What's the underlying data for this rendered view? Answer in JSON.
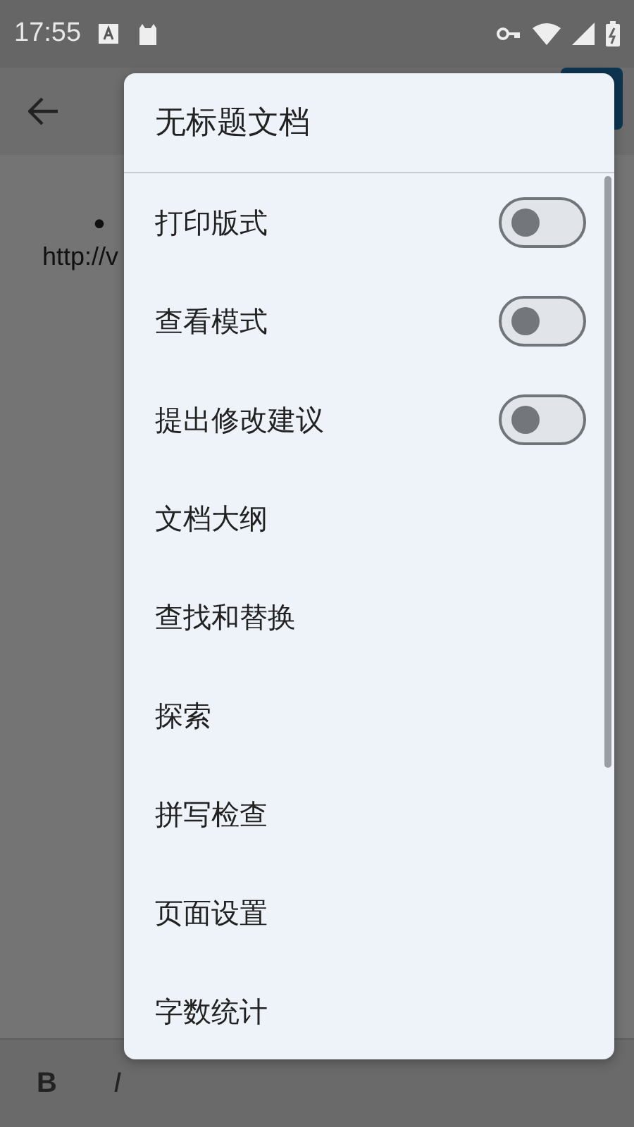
{
  "status_bar": {
    "time": "17:55"
  },
  "document": {
    "bullet": "•",
    "text": "http://v"
  },
  "format_toolbar": {
    "bold": "B",
    "italic": "I"
  },
  "menu": {
    "title": "无标题文档",
    "items": [
      {
        "kind": "toggle",
        "label": "打印版式",
        "on": false
      },
      {
        "kind": "toggle",
        "label": "查看模式",
        "on": false
      },
      {
        "kind": "toggle",
        "label": "提出修改建议",
        "on": false
      },
      {
        "kind": "action",
        "label": "文档大纲"
      },
      {
        "kind": "action",
        "label": "查找和替换"
      },
      {
        "kind": "action",
        "label": "探索"
      },
      {
        "kind": "action",
        "label": "拼写检查"
      },
      {
        "kind": "action",
        "label": "页面设置"
      },
      {
        "kind": "action",
        "label": "字数统计"
      }
    ]
  }
}
